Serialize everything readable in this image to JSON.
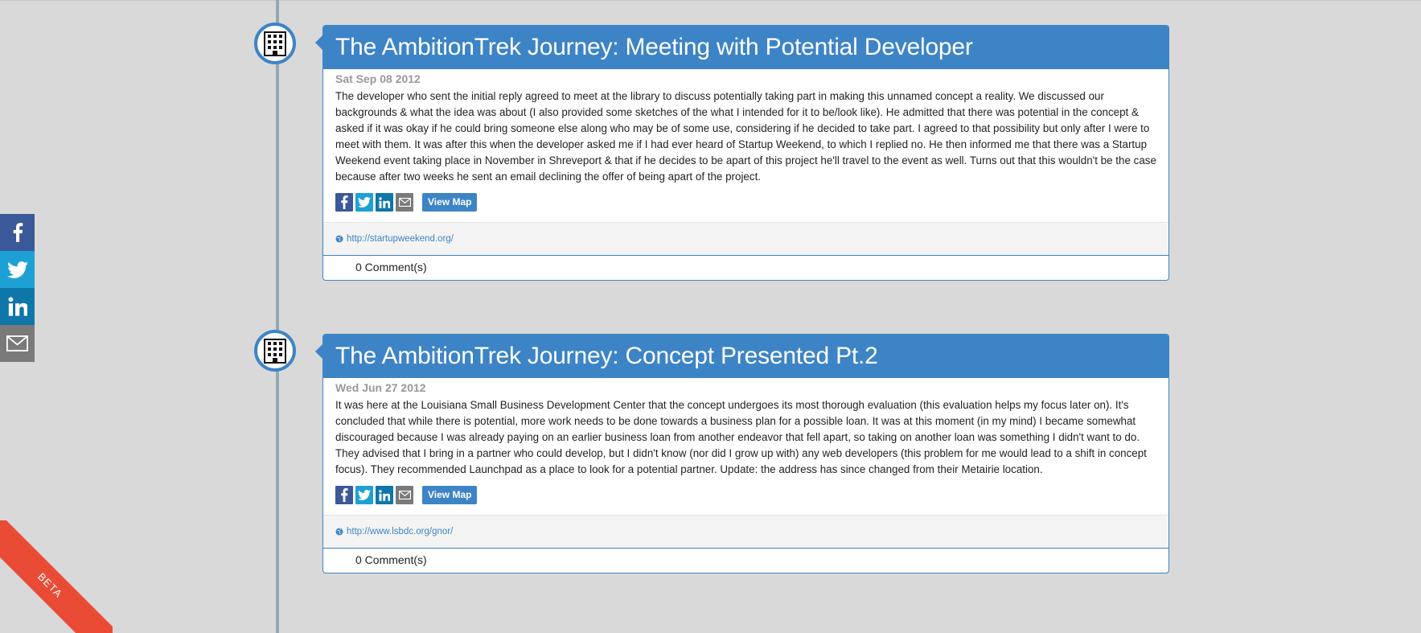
{
  "side_share": {
    "icons": [
      "facebook-icon",
      "twitter-icon",
      "linkedin-icon",
      "email-icon"
    ],
    "colors": {
      "facebook": "#3b5998",
      "twitter": "#1da1d5",
      "linkedin": "#0e76a8",
      "email": "#7a7a7a"
    }
  },
  "entries": [
    {
      "icon": "building-icon",
      "title": "The AmbitionTrek Journey: Meeting with Potential Developer",
      "date": "Sat Sep 08 2012",
      "body": "The developer who sent the initial reply agreed to meet at the library to discuss potentially taking part in making this unnamed concept a reality. We discussed our backgrounds & what the idea was about (I also provided some sketches of the what I intended for it to be/look like). He admitted that there was potential in the concept & asked if it was okay if he could bring someone else along who may be of some use, considering if he decided to take part. I agreed to that possibility but only after I were to meet with them. It was after this when the developer asked me if I had ever heard of Startup Weekend, to which I replied no. He then informed me that there was a Startup Weekend event taking place in November in Shreveport & that if he decides to be apart of this project he'll travel to the event as well. Turns out that this wouldn't be the case because after two weeks he sent an email declining the offer of being apart of the project.",
      "view_map": "View Map",
      "link": "http://startupweekend.org/",
      "comments": "0 Comment(s)"
    },
    {
      "icon": "building-icon",
      "title": "The AmbitionTrek Journey: Concept Presented Pt.2",
      "date": "Wed Jun 27 2012",
      "body": "It was here at the Louisiana Small Business Development Center that the concept undergoes its most thorough evaluation (this evaluation helps my focus later on). It's concluded that while there is potential, more work needs to be done towards a business plan for a possible loan. It was at this moment (in my mind) I became somewhat discouraged because I was already paying on an earlier business loan from another endeavor that fell apart, so taking on another loan was something I didn't want to do. They advised that I bring in a partner who could develop, but I didn't know (nor did I grow up with) any web developers (this problem for me would lead to a shift in concept focus). They recommended Launchpad as a place to look for a potential partner. Update: the address has since changed from their Metairie location.",
      "view_map": "View Map",
      "link": "http://www.lsbdc.org/gnor/",
      "comments": "0 Comment(s)"
    }
  ],
  "beta_ribbon": "BETA",
  "colors": {
    "accent": "#3d84c6",
    "background": "#d9d9d9",
    "ribbon": "#ea4b35",
    "timeline": "#96a7b1"
  }
}
